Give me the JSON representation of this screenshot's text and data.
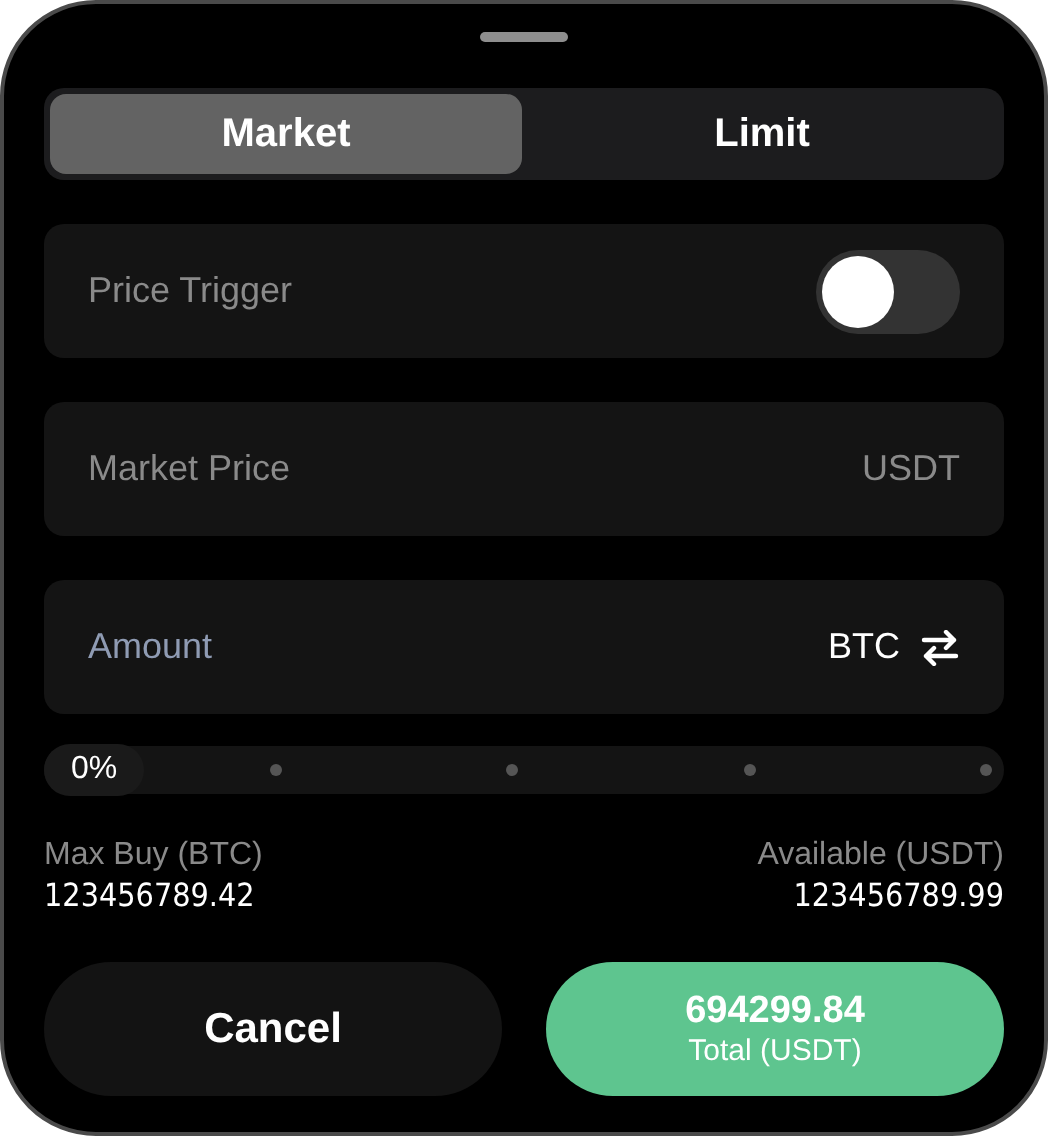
{
  "tabs": [
    {
      "label": "Market",
      "selected": true
    },
    {
      "label": "Limit",
      "selected": false
    }
  ],
  "price_trigger": {
    "label": "Price Trigger",
    "on": false
  },
  "market_price": {
    "placeholder": "Market Price",
    "unit": "USDT"
  },
  "amount": {
    "placeholder": "Amount",
    "unit": "BTC"
  },
  "slider": {
    "level": 0,
    "reading": "0%"
  },
  "max_buy": {
    "label": "Max Buy (BTC)",
    "value": "123456789.42"
  },
  "available": {
    "label": "Available (USDT)",
    "value": "123456789.99"
  },
  "buttons": {
    "cancel": "Cancel",
    "total_value": "694299.84",
    "total_label": "Total (USDT)"
  }
}
